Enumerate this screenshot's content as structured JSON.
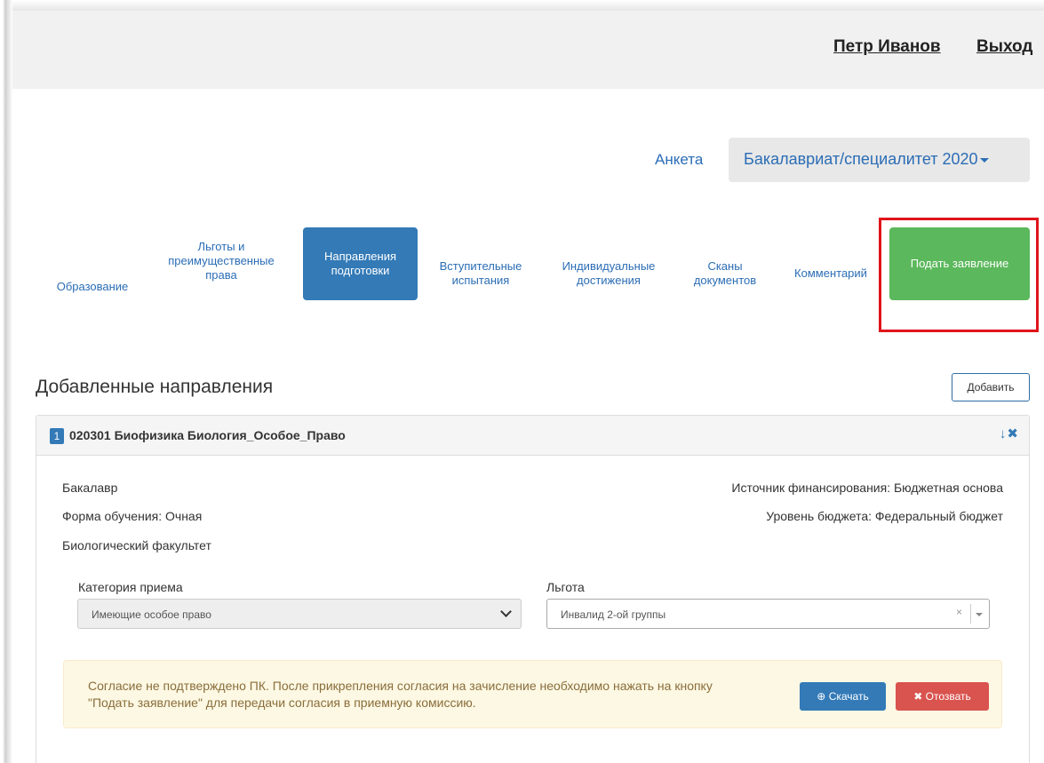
{
  "header": {
    "user_name": "Петр Иванов",
    "logout_label": "Выход"
  },
  "nav": {
    "anketa_label": "Анкета",
    "program_selected": "Бакалавриат/специалитет 2020"
  },
  "tabs": [
    {
      "label": "Образование",
      "active": false
    },
    {
      "label": "Льготы и преимущественные права",
      "active": false
    },
    {
      "label": "Направления подготовки",
      "active": true
    },
    {
      "label": "Вступительные испытания",
      "active": false
    },
    {
      "label": "Индивидуальные достижения",
      "active": false
    },
    {
      "label": "Сканы документов",
      "active": false
    },
    {
      "label": "Комментарий",
      "active": false
    }
  ],
  "submit_button": "Подать заявление",
  "section": {
    "title": "Добавленные направления",
    "add_label": "Добавить"
  },
  "direction": {
    "number": "1",
    "title": "020301 Биофизика Биология_Особое_Право",
    "level": "Бакалавр",
    "study_form": "Форма обучения: Очная",
    "faculty": "Биологический факультет",
    "funding_source": "Источник финансирования: Бюджетная основа",
    "budget_level": "Уровень бюджета: Федеральный бюджет",
    "category_label": "Категория приема",
    "category_value": "Имеющие особое право",
    "benefit_label": "Льгота",
    "benefit_value": "Инвалид 2-ой группы"
  },
  "alert": {
    "text": "Согласие не подтверждено ПК. После прикрепления согласия на зачисление необходимо нажать на кнопку \"Подать заявление\" для передачи согласия в приемную комиссию.",
    "download_label": "Скачать",
    "revoke_label": "Отозвать"
  },
  "colors": {
    "primary": "#337ab7",
    "success": "#5cb85c",
    "danger": "#d9534f",
    "highlight": "#e0141b",
    "alert_bg": "#fcf8e3"
  }
}
